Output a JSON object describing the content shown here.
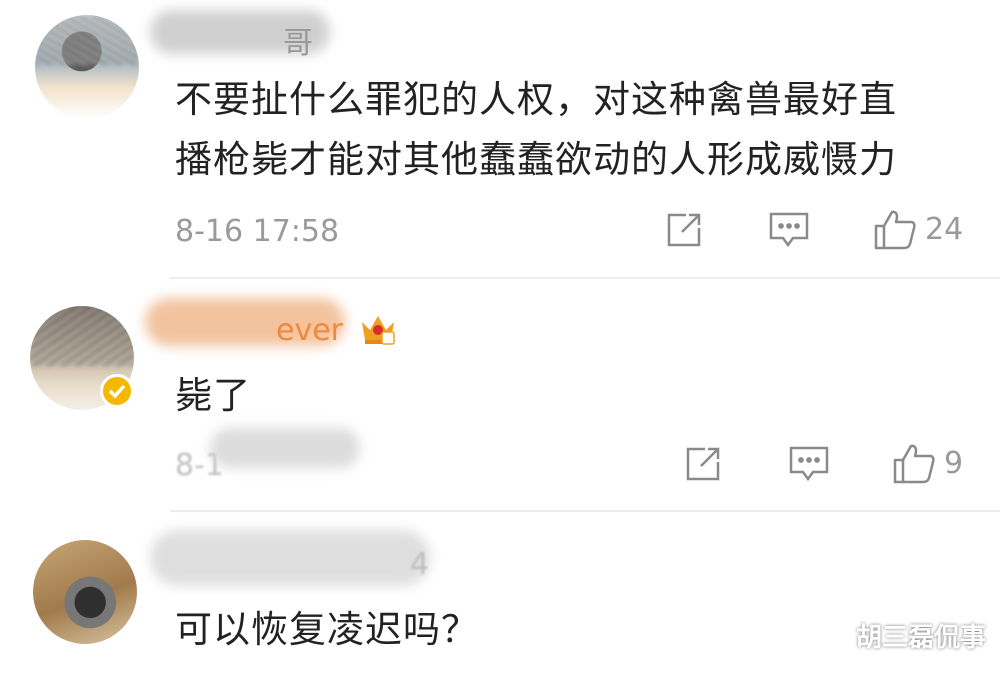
{
  "comments": [
    {
      "username": "哥",
      "text_line1": "不要扯什么罪犯的人权，对这种禽兽最好直",
      "text_line2": "播枪毙才能对其他蠢蠢欲动的人形成威慑力",
      "time": "8-16 17:58",
      "likes": "24"
    },
    {
      "username": "ever",
      "text_line1": "毙了",
      "time": "8-1",
      "likes": "9"
    },
    {
      "username": "",
      "meta": "4",
      "text_line1": "可以恢复凌迟吗？"
    }
  ],
  "icons": {
    "share": "share-icon",
    "comment": "comment-icon",
    "like": "thumbs-up-icon",
    "crown": "crown-badge-icon",
    "verified": "verified-badge-icon"
  },
  "colors": {
    "text": "#222222",
    "meta": "#9a9a9a",
    "verified": "#f5b800",
    "crown": "#f0a020"
  },
  "watermark": "胡三磊侃事"
}
